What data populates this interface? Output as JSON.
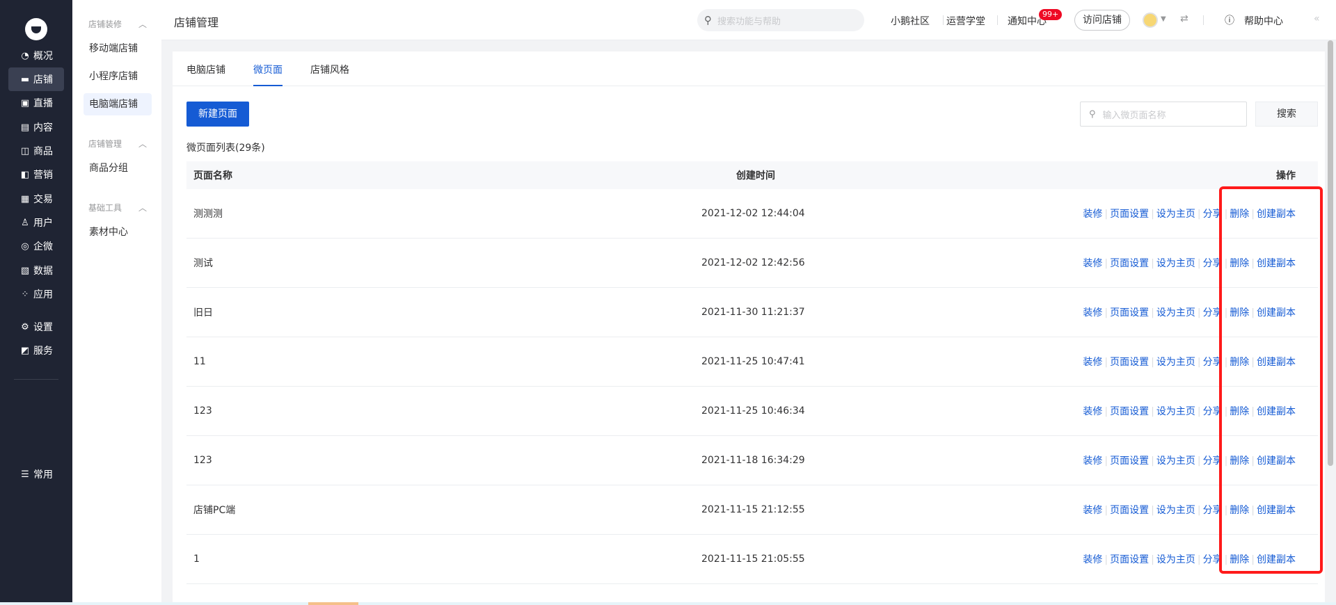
{
  "nav": {
    "items": [
      {
        "label": "概况",
        "icon": "pie-chart-icon",
        "glyph": "◔"
      },
      {
        "label": "店铺",
        "icon": "store-icon",
        "glyph": "▬"
      },
      {
        "label": "直播",
        "icon": "live-icon",
        "glyph": "▣"
      },
      {
        "label": "内容",
        "icon": "document-icon",
        "glyph": "▤"
      },
      {
        "label": "商品",
        "icon": "goods-icon",
        "glyph": "◫"
      },
      {
        "label": "营销",
        "icon": "megaphone-icon",
        "glyph": "◧"
      },
      {
        "label": "交易",
        "icon": "trade-icon",
        "glyph": "▦"
      },
      {
        "label": "用户",
        "icon": "user-icon",
        "glyph": "♙"
      },
      {
        "label": "企微",
        "icon": "wechat-work-icon",
        "glyph": "◎"
      },
      {
        "label": "数据",
        "icon": "data-icon",
        "glyph": "▧"
      },
      {
        "label": "应用",
        "icon": "apps-icon",
        "glyph": "⁘"
      },
      {
        "label": "设置",
        "icon": "gear-icon",
        "glyph": "⚙"
      },
      {
        "label": "服务",
        "icon": "service-icon",
        "glyph": "◩"
      },
      {
        "label": "常用",
        "icon": "list-icon",
        "glyph": "☰"
      }
    ],
    "active_index": 1
  },
  "subnav": {
    "groups": [
      {
        "title": "店铺装修",
        "items": [
          "移动端店铺",
          "小程序店铺",
          "电脑端店铺"
        ]
      },
      {
        "title": "店铺管理",
        "items": [
          "商品分组"
        ]
      },
      {
        "title": "基础工具",
        "items": [
          "素材中心"
        ]
      }
    ],
    "active_item": "电脑端店铺"
  },
  "header": {
    "title": "店铺管理",
    "search_placeholder": "搜索功能与帮助",
    "links": [
      "小鹅社区",
      "运营学堂",
      "通知中心"
    ],
    "badge": "99+",
    "visit_button": "访问店铺",
    "help": "帮助中心"
  },
  "tabs": [
    "电脑店铺",
    "微页面",
    "店铺风格"
  ],
  "active_tab": 1,
  "toolbar": {
    "new_button": "新建页面",
    "search_placeholder": "输入微页面名称",
    "search_button": "搜索"
  },
  "list": {
    "title": "微页面列表(29条)",
    "columns": [
      "页面名称",
      "创建时间",
      "操作"
    ],
    "rows": [
      {
        "name": "测测测",
        "time": "2021-12-02 12:44:04"
      },
      {
        "name": "测试",
        "time": "2021-12-02 12:42:56"
      },
      {
        "name": "旧日",
        "time": "2021-11-30 11:21:37"
      },
      {
        "name": "11",
        "time": "2021-11-25 10:47:41"
      },
      {
        "name": "123",
        "time": "2021-11-25 10:46:34"
      },
      {
        "name": "123",
        "time": "2021-11-18 16:34:29"
      },
      {
        "name": "店铺PC端",
        "time": "2021-11-15 21:12:55"
      },
      {
        "name": "1",
        "time": "2021-11-15 21:05:55"
      }
    ],
    "actions": [
      "装修",
      "页面设置",
      "设为主页",
      "分享",
      "删除",
      "创建副本"
    ]
  },
  "colors": {
    "accent": "#155bd4",
    "nav_bg": "#1f2433",
    "highlight": "#ff1a1a"
  }
}
